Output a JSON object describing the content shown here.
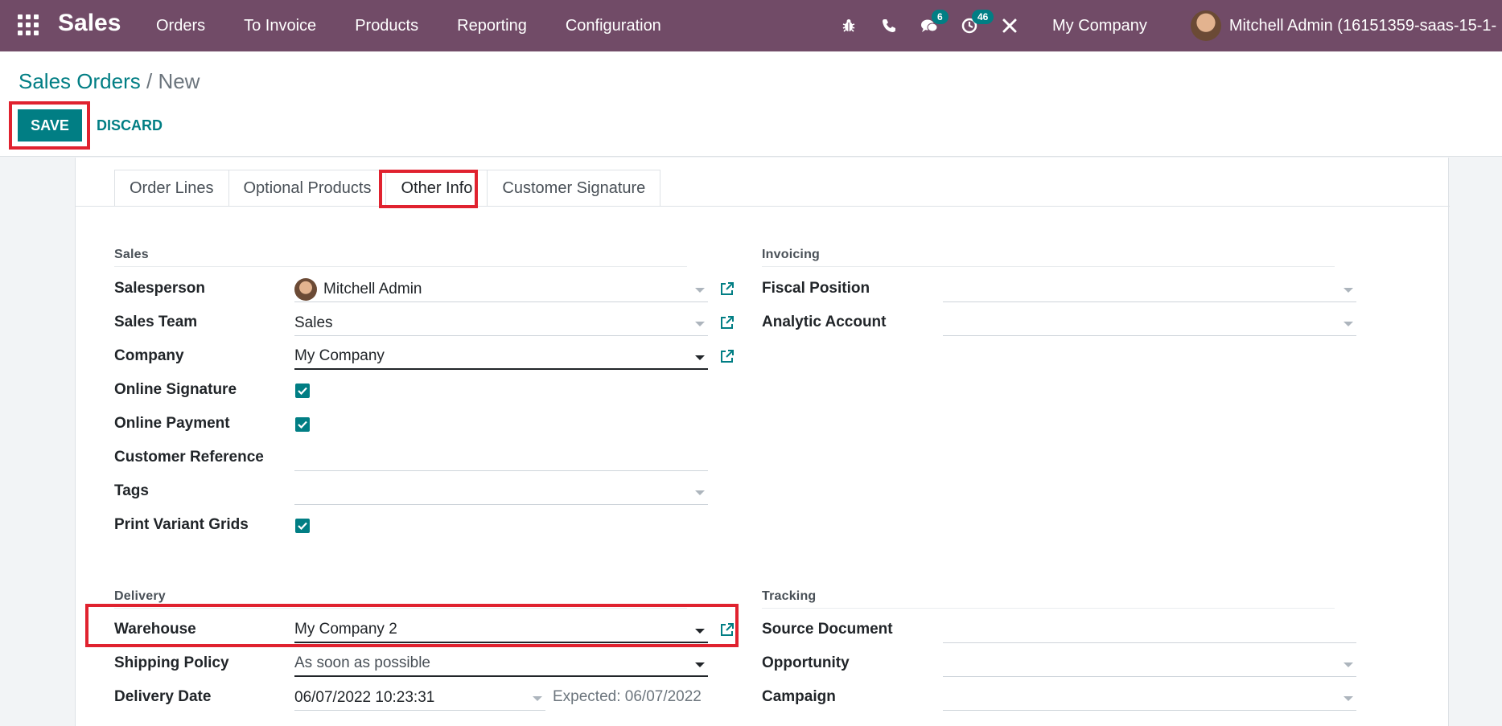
{
  "navbar": {
    "app_name": "Sales",
    "menu": [
      "Orders",
      "To Invoice",
      "Products",
      "Reporting",
      "Configuration"
    ],
    "messages_count": "6",
    "activities_count": "46",
    "company": "My Company",
    "user": "Mitchell Admin (16151359-saas-15-1-"
  },
  "control": {
    "breadcrumb_parent": "Sales Orders",
    "breadcrumb_sep": "/",
    "breadcrumb_current": "New",
    "save_label": "SAVE",
    "discard_label": "DISCARD"
  },
  "tabs": [
    "Order Lines",
    "Optional Products",
    "Other Info",
    "Customer Signature"
  ],
  "sales": {
    "title": "Sales",
    "salesperson_label": "Salesperson",
    "salesperson_value": "Mitchell Admin",
    "sales_team_label": "Sales Team",
    "sales_team_value": "Sales",
    "company_label": "Company",
    "company_value": "My Company",
    "online_signature_label": "Online Signature",
    "online_payment_label": "Online Payment",
    "customer_reference_label": "Customer Reference",
    "customer_reference_value": "",
    "tags_label": "Tags",
    "print_variant_grids_label": "Print Variant Grids"
  },
  "invoicing": {
    "title": "Invoicing",
    "fiscal_position_label": "Fiscal Position",
    "analytic_account_label": "Analytic Account"
  },
  "delivery": {
    "title": "Delivery",
    "warehouse_label": "Warehouse",
    "warehouse_value": "My Company 2",
    "shipping_policy_label": "Shipping Policy",
    "shipping_policy_value": "As soon as possible",
    "delivery_date_label": "Delivery Date",
    "delivery_date_value": "06/07/2022 10:23:31",
    "expected_text": "Expected: 06/07/2022"
  },
  "tracking": {
    "title": "Tracking",
    "source_document_label": "Source Document",
    "opportunity_label": "Opportunity",
    "campaign_label": "Campaign"
  },
  "colors": {
    "navbar": "#714b67",
    "primary": "#017e84",
    "highlight": "#e0222f"
  }
}
